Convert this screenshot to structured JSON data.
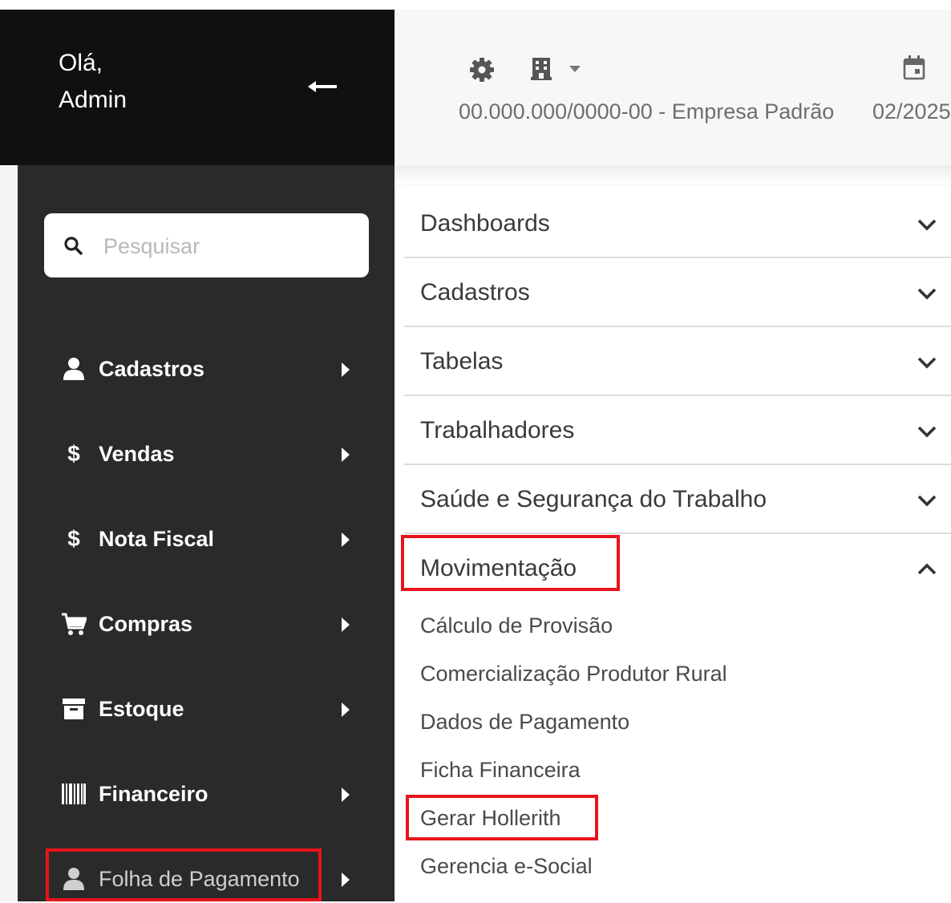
{
  "sidebar": {
    "greeting_line1": "Olá,",
    "greeting_line2": "Admin",
    "back_icon": "arrow-left-icon",
    "search": {
      "placeholder": "Pesquisar",
      "value": ""
    },
    "items": [
      {
        "label": "Cadastros",
        "icon": "user-icon"
      },
      {
        "label": "Vendas",
        "icon": "dollar-icon"
      },
      {
        "label": "Nota Fiscal",
        "icon": "dollar-icon"
      },
      {
        "label": "Compras",
        "icon": "cart-icon"
      },
      {
        "label": "Estoque",
        "icon": "archive-icon"
      },
      {
        "label": "Financeiro",
        "icon": "barcode-icon"
      },
      {
        "label": "Folha de Pagamento",
        "icon": "user-icon",
        "active": true
      }
    ]
  },
  "topbar": {
    "settings_icon": "gear-icon",
    "company_icon": "building-icon",
    "dropdown_icon": "caret-down-icon",
    "calendar_icon": "calendar-icon",
    "company": "00.000.000/0000-00 - Empresa Padrão",
    "period": "02/2025"
  },
  "menu": {
    "sections": [
      {
        "label": "Dashboards",
        "expanded": false
      },
      {
        "label": "Cadastros",
        "expanded": false
      },
      {
        "label": "Tabelas",
        "expanded": false
      },
      {
        "label": "Trabalhadores",
        "expanded": false
      },
      {
        "label": "Saúde e Segurança do Trabalho",
        "expanded": false
      },
      {
        "label": "Movimentação",
        "expanded": true
      }
    ],
    "movimentacao_items": [
      "Cálculo de Provisão",
      "Comercialização Produtor Rural",
      "Dados de Pagamento",
      "Ficha Financeira",
      "Gerar Hollerith",
      "Gerencia e-Social"
    ]
  },
  "colors": {
    "sidebar_top": "#101010",
    "sidebar_body": "#2a2a2a",
    "highlight": "#e8141c",
    "text_dark": "#3a3a3a"
  }
}
